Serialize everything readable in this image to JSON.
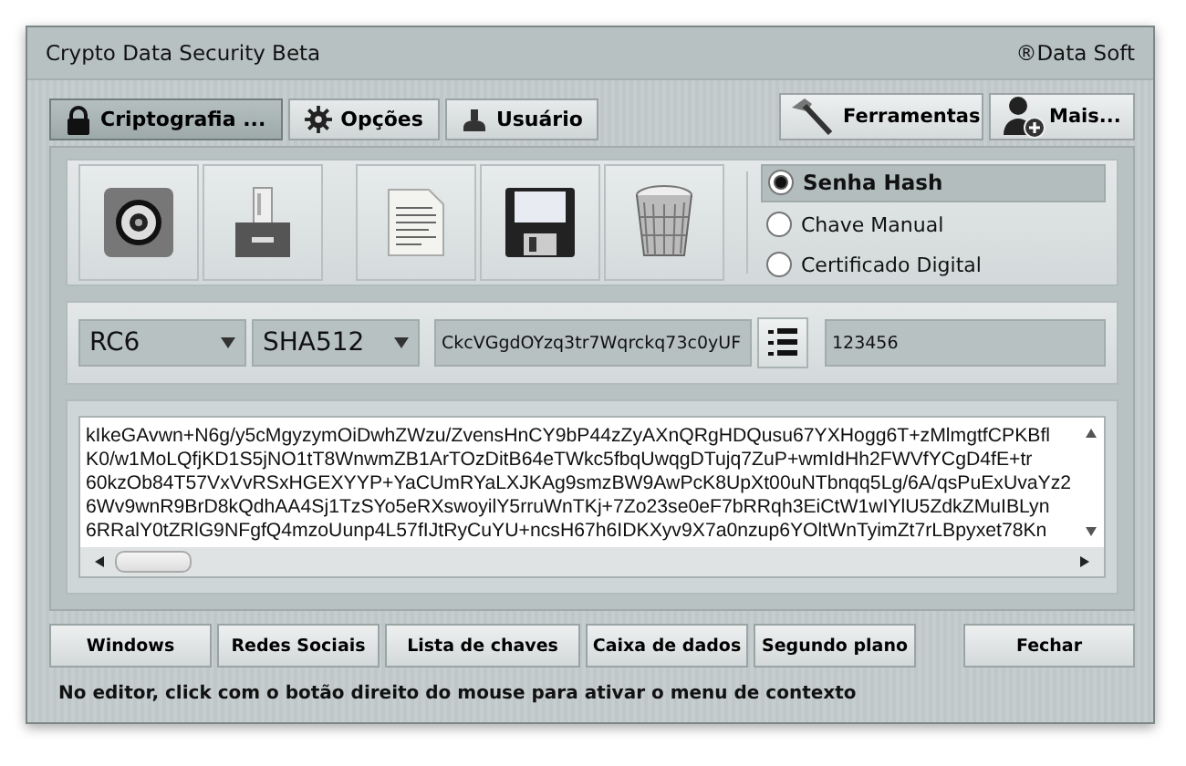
{
  "window": {
    "title": "Crypto Data Security Beta",
    "brand": "®Data Soft"
  },
  "tabs": [
    {
      "label": "Criptografia ...",
      "selected": true
    },
    {
      "label": "Opções",
      "selected": false
    },
    {
      "label": "Usuário",
      "selected": false
    }
  ],
  "tool_buttons": [
    {
      "label": "Ferramentas"
    },
    {
      "label": "Mais..."
    }
  ],
  "modes": [
    {
      "label": "Senha Hash",
      "selected": true
    },
    {
      "label": "Chave Manual",
      "selected": false
    },
    {
      "label": "Certificado Digital",
      "selected": false
    }
  ],
  "algorithm": {
    "value": "RC6"
  },
  "hash": {
    "value": "SHA512"
  },
  "key_field": {
    "value": "CkcVGgdOYzq3tr7Wqrckq73c0yUF"
  },
  "password_field": {
    "value": "123456"
  },
  "editor": {
    "lines": [
      "kIkeGAvwn+N6g/y5cMgyzymOiDwhZWzu/ZvensHnCY9bP44zZyAXnQRgHDQusu67YXHogg6T+zMlmgtfCPKBfl",
      "K0/w1MoLQfjKD1S5jNO1tT8WnwmZB1ArTOzDitB64eTWkc5fbqUwqgDTujq7ZuP+wmIdHh2FWVfYCgD4fE+tr",
      "60kzOb84T57VxVvRSxHGEXYYP+YaCUmRYaLXJKAg9smzBW9AwPcK8UpXt00uNTbnqq5Lg/6A/qsPuExUvaYz2",
      "6Wv9wnR9BrD8kQdhAA4Sj1TzSYo5eRXswoyilY5rruWnTKj+7Zo23se0eF7bRRqh3EiCtW1wIYlU5ZdkZMuIBLyn",
      "6RRalY0tZRlG9NFgfQ4mzoUunp4L57fIJtRyCuYU+ncsH67h6IDKXyv9X7a0nzup6YOltWnTyimZt7rLBpyxet78Kn"
    ]
  },
  "bottom_buttons": [
    {
      "label": "Windows"
    },
    {
      "label": "Redes Sociais"
    },
    {
      "label": "Lista de chaves"
    },
    {
      "label": "Caixa de dados"
    },
    {
      "label": "Segundo plano"
    }
  ],
  "close_button": {
    "label": "Fechar"
  },
  "status_bar": {
    "text": "No editor, click com o botão direito do mouse para ativar o menu de contexto"
  }
}
